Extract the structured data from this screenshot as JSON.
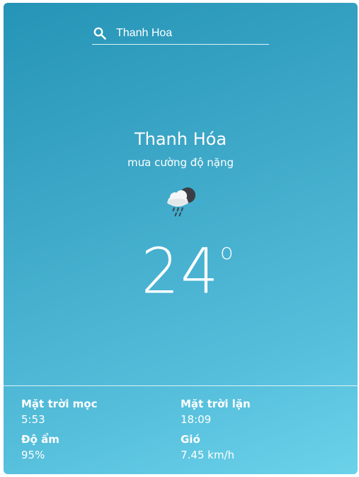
{
  "search": {
    "value": "Thanh Hoa",
    "icon": "search-icon"
  },
  "weather": {
    "city": "Thanh Hóa",
    "description": "mưa cường độ nặng",
    "icon": "cloud-rain-night-icon",
    "temperature": "24",
    "degree_symbol": "o"
  },
  "stats": {
    "sunrise": {
      "label": "Mặt trời mọc",
      "value": "5:53"
    },
    "sunset": {
      "label": "Mặt trời lặn",
      "value": "18:09"
    },
    "humidity": {
      "label": "Độ ẩm",
      "value": "95%"
    },
    "wind": {
      "label": "Gió",
      "value": "7.45 km/h"
    }
  },
  "colors": {
    "gradient_start": "#2594b6",
    "gradient_end": "#6bd2ea",
    "text": "#ffffff"
  }
}
